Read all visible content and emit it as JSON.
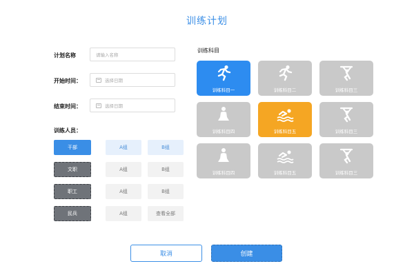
{
  "page": {
    "title": "训练计划"
  },
  "form": {
    "name_label": "计划名称",
    "name_placeholder": "请输入名称",
    "start_label": "开始时间：",
    "start_placeholder": "选择日期",
    "end_label": "结束时间：",
    "end_placeholder": "选择日期"
  },
  "personnel": {
    "label": "训练人员：",
    "rows": [
      {
        "role": "干部",
        "g1": "A组",
        "g2": "B组"
      },
      {
        "role": "文职",
        "g1": "A组",
        "g2": "B组"
      },
      {
        "role": "职工",
        "g1": "A组",
        "g2": "B组"
      },
      {
        "role": "民兵",
        "g1": "A组",
        "g2": "查看全部"
      }
    ]
  },
  "subjects": {
    "label": "训练科目",
    "items": [
      {
        "label": "训练科目一",
        "icon": "running-icon",
        "state": "selected-blue"
      },
      {
        "label": "训练科目二",
        "icon": "running-icon",
        "state": "default"
      },
      {
        "label": "训练科目三",
        "icon": "weightlifting-icon",
        "state": "default"
      },
      {
        "label": "训练科目四",
        "icon": "person-sitting-icon",
        "state": "default"
      },
      {
        "label": "训练科目五",
        "icon": "swimming-icon",
        "state": "selected-orange"
      },
      {
        "label": "训练科目三",
        "icon": "weightlifting-icon",
        "state": "default"
      },
      {
        "label": "训练科目四",
        "icon": "person-sitting-icon",
        "state": "default"
      },
      {
        "label": "训练科目五",
        "icon": "swimming-icon",
        "state": "default"
      },
      {
        "label": "训练科目三",
        "icon": "weightlifting-icon",
        "state": "default"
      }
    ]
  },
  "actions": {
    "cancel": "取消",
    "create": "创建"
  },
  "colors": {
    "primary": "#3a8ee6",
    "orange": "#f5a623",
    "gray": "#c9c9c9",
    "dark": "#6f7379"
  }
}
